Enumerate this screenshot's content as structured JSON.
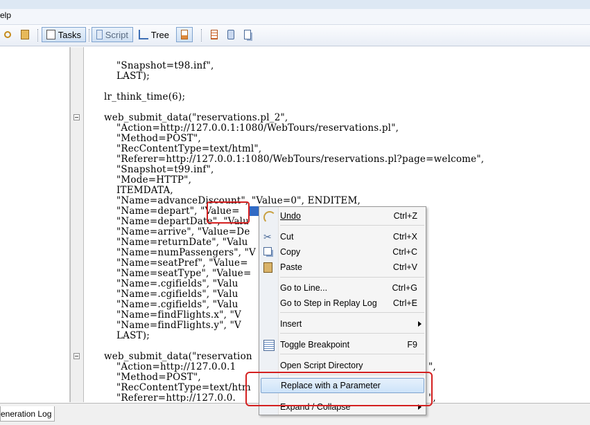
{
  "menubar": {
    "help_fragment": "elp"
  },
  "toolbar": {
    "tasks_label": "Tasks",
    "script_label": "Script",
    "tree_label": "Tree"
  },
  "code_lines": [
    "    \"Snapshot=t98.inf\",",
    "    LAST);",
    "",
    "lr_think_time(6);",
    "",
    "web_submit_data(\"reservations.pl_2\",",
    "    \"Action=http://127.0.0.1:1080/WebTours/reservations.pl\",",
    "    \"Method=POST\",",
    "    \"RecContentType=text/html\",",
    "    \"Referer=http://127.0.0.1:1080/WebTours/reservations.pl?page=welcome\",",
    "    \"Snapshot=t99.inf\",",
    "    \"Mode=HTTP\",",
    "    ITEMDATA,",
    "    \"Name=advanceDiscount\", \"Value=0\", ENDITEM,",
    "    \"Name=depart\", \"Value=",
    "    \"Name=departDate\", \"Valu",
    "    \"Name=arrive\", \"Value=De",
    "    \"Name=returnDate\", \"Valu",
    "    \"Name=numPassengers\", \"V",
    "    \"Name=seatPref\", \"Value=",
    "    \"Name=seatType\", \"Value=",
    "    \"Name=.cgifields\", \"Valu",
    "    \"Name=.cgifields\", \"Valu",
    "    \"Name=.cgifields\", \"Valu",
    "    \"Name=findFlights.x\", \"V",
    "    \"Name=findFlights.y\", \"V",
    "    LAST);",
    "",
    "web_submit_data(\"reservation",
    "    \"Action=http://127.0.0.1",
    "    \"Method=POST\",",
    "    \"RecContentType=text/htm",
    "    \"Referer=http://127.0.0."
  ],
  "code_right_tails": {
    "line28": "\",",
    "line31": "\","
  },
  "context_menu": {
    "items": [
      {
        "label": "Undo",
        "shortcut": "Ctrl+Z",
        "icon": "undo-icon"
      },
      {
        "label": "Cut",
        "shortcut": "Ctrl+X",
        "icon": "cut-icon"
      },
      {
        "label": "Copy",
        "shortcut": "Ctrl+C",
        "icon": "copy-icon"
      },
      {
        "label": "Paste",
        "shortcut": "Ctrl+V",
        "icon": "paste-icon"
      },
      {
        "label": "Go to Line...",
        "shortcut": "Ctrl+G"
      },
      {
        "label": "Go to Step in Replay Log",
        "shortcut": "Ctrl+E"
      },
      {
        "label": "Insert",
        "submenu": true
      },
      {
        "label": "Toggle Breakpoint",
        "shortcut": "F9",
        "icon": "breakpoint-icon"
      },
      {
        "label": "Open Script Directory"
      },
      {
        "label": "Replace with a Parameter",
        "highlighted": true
      },
      {
        "label": "Expand / Collapse",
        "submenu": true
      }
    ]
  },
  "bottom": {
    "tab_label": "eneration Log"
  },
  "colors": {
    "highlight_red": "#d42020",
    "menu_hover": "#cde3f9",
    "selection": "#316ac5"
  }
}
